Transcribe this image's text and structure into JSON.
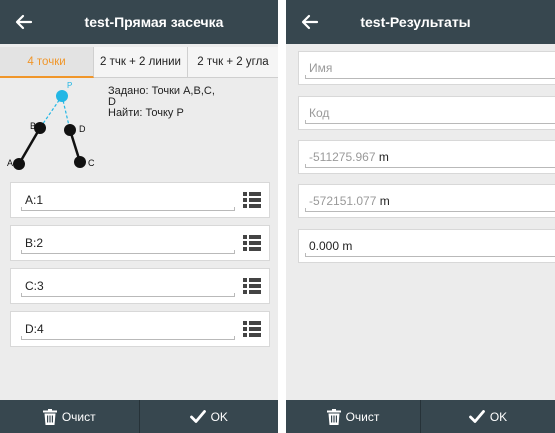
{
  "left": {
    "title": "test-Прямая засечка",
    "tabs": [
      {
        "label": "4 точки",
        "active": true
      },
      {
        "label": "2 тчк + 2 линии",
        "active": false
      },
      {
        "label": "2 тчк + 2 угла",
        "active": false
      }
    ],
    "diagram": {
      "point_labels": [
        "P",
        "A",
        "B",
        "C",
        "D"
      ],
      "given_text": "Задано: Точки А,В,С,\nD",
      "find_text": "Найти: Точку Р",
      "point_color": "#23b7e5",
      "line_color": "#23b7e5"
    },
    "rows": [
      {
        "label": "A:1"
      },
      {
        "label": "B:2"
      },
      {
        "label": "C:3"
      },
      {
        "label": "D:4"
      }
    ],
    "bottom": {
      "clear_label": "Очист",
      "ok_label": "OK"
    }
  },
  "right": {
    "title": "test-Результаты",
    "fields": {
      "name_placeholder": "Имя",
      "code_placeholder": "Код",
      "x_value": "-511275.967",
      "x_unit": "m",
      "y_value": "-572151.077",
      "y_unit": "m",
      "h_value": "0.000 m"
    },
    "bottom": {
      "clear_label": "Очист",
      "ok_label": "OK"
    }
  },
  "colors": {
    "appbar": "#37474f",
    "background": "#ececec",
    "accent": "#f0962a"
  }
}
